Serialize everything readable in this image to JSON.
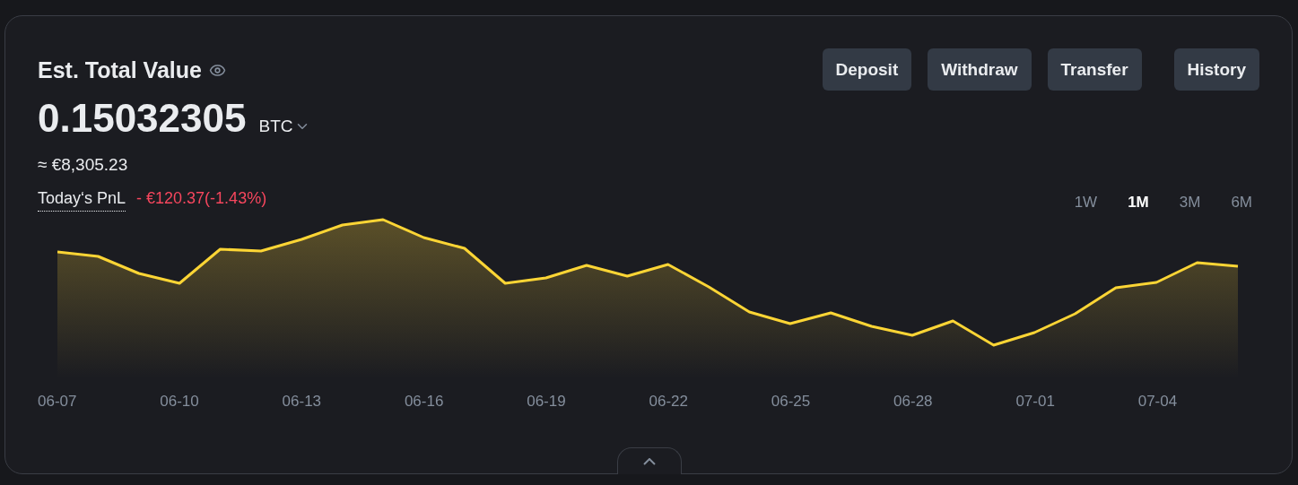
{
  "title": "Est. Total Value",
  "balance": {
    "amount": "0.15032305",
    "currency": "BTC"
  },
  "fiat_value": "≈ €8,305.23",
  "pnl": {
    "label": "Today‘s PnL",
    "value": "- €120.37(-1.43%)"
  },
  "buttons": [
    "Deposit",
    "Withdraw",
    "Transfer",
    "History"
  ],
  "periods": [
    {
      "label": "1W",
      "selected": false
    },
    {
      "label": "1M",
      "selected": true
    },
    {
      "label": "3M",
      "selected": false
    },
    {
      "label": "6M",
      "selected": false
    }
  ],
  "x_labels": [
    "06-07",
    "06-10",
    "06-13",
    "06-16",
    "06-19",
    "06-22",
    "06-25",
    "06-28",
    "07-01",
    "07-04"
  ]
}
